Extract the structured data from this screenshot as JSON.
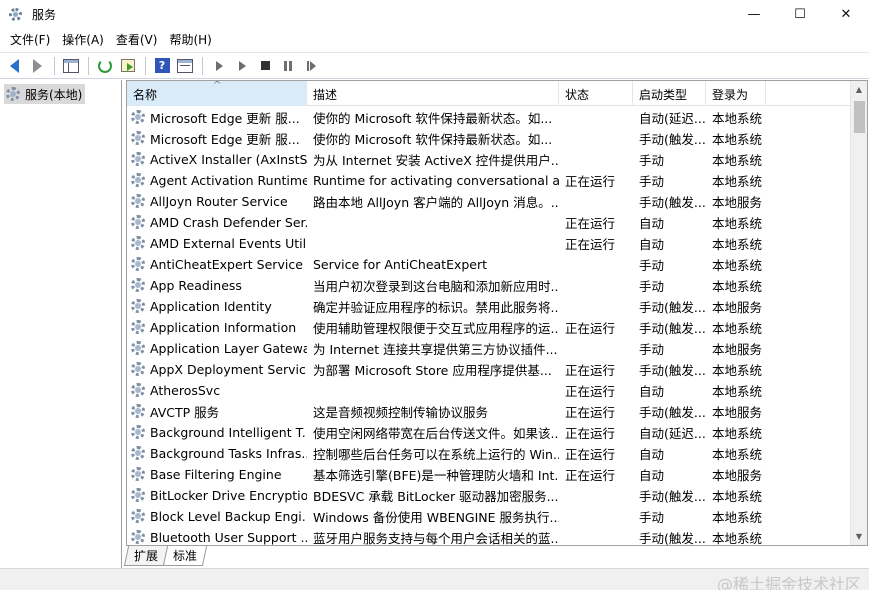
{
  "window": {
    "title": "服务",
    "controls": {
      "minimize": "—",
      "maximize": "☐",
      "close": "✕"
    }
  },
  "menu": [
    "文件(F)",
    "操作(A)",
    "查看(V)",
    "帮助(H)"
  ],
  "toolbar": {
    "icons": [
      "back-arrow-icon",
      "forward-arrow-icon",
      "console-tree-icon",
      "refresh-icon",
      "export-list-icon",
      "help-icon",
      "properties-icon",
      "start-service-icon",
      "start-service-alt-icon",
      "stop-service-icon",
      "pause-service-icon",
      "restart-service-icon"
    ],
    "help_glyph": "?"
  },
  "tree": {
    "root_label": "服务(本地)"
  },
  "columns": {
    "name": "名称",
    "desc": "描述",
    "status": "状态",
    "start": "启动类型",
    "logon": "登录为",
    "sort_indicator": "^"
  },
  "services": [
    {
      "name": "Microsoft Edge 更新 服...",
      "desc": "使你的 Microsoft 软件保持最新状态。如...",
      "status": "",
      "start": "自动(延迟...",
      "logon": "本地系统"
    },
    {
      "name": "Microsoft Edge 更新 服...",
      "desc": "使你的 Microsoft 软件保持最新状态。如...",
      "status": "",
      "start": "手动(触发...",
      "logon": "本地系统"
    },
    {
      "name": "ActiveX Installer (AxInstSV)",
      "desc": "为从 Internet 安装 ActiveX 控件提供用户...",
      "status": "",
      "start": "手动",
      "logon": "本地系统"
    },
    {
      "name": "Agent Activation Runtime...",
      "desc": "Runtime for activating conversational a...",
      "status": "正在运行",
      "start": "手动",
      "logon": "本地系统"
    },
    {
      "name": "AllJoyn Router Service",
      "desc": "路由本地 AllJoyn 客户端的 AllJoyn 消息。...",
      "status": "",
      "start": "手动(触发...",
      "logon": "本地服务"
    },
    {
      "name": "AMD Crash Defender Ser...",
      "desc": "",
      "status": "正在运行",
      "start": "自动",
      "logon": "本地系统"
    },
    {
      "name": "AMD External Events Utility",
      "desc": "",
      "status": "正在运行",
      "start": "自动",
      "logon": "本地系统"
    },
    {
      "name": "AntiCheatExpert Service",
      "desc": "Service for AntiCheatExpert",
      "status": "",
      "start": "手动",
      "logon": "本地系统"
    },
    {
      "name": "App Readiness",
      "desc": "当用户初次登录到这台电脑和添加新应用时...",
      "status": "",
      "start": "手动",
      "logon": "本地系统"
    },
    {
      "name": "Application Identity",
      "desc": "确定并验证应用程序的标识。禁用此服务将...",
      "status": "",
      "start": "手动(触发...",
      "logon": "本地服务"
    },
    {
      "name": "Application Information",
      "desc": "使用辅助管理权限便于交互式应用程序的运...",
      "status": "正在运行",
      "start": "手动(触发...",
      "logon": "本地系统"
    },
    {
      "name": "Application Layer Gatewa...",
      "desc": "为 Internet 连接共享提供第三方协议插件...",
      "status": "",
      "start": "手动",
      "logon": "本地服务"
    },
    {
      "name": "AppX Deployment Servic...",
      "desc": "为部署 Microsoft Store 应用程序提供基...",
      "status": "正在运行",
      "start": "手动(触发...",
      "logon": "本地系统"
    },
    {
      "name": "AtherosSvc",
      "desc": "",
      "status": "正在运行",
      "start": "自动",
      "logon": "本地系统"
    },
    {
      "name": "AVCTP 服务",
      "desc": "这是音频视频控制传输协议服务",
      "status": "正在运行",
      "start": "手动(触发...",
      "logon": "本地服务"
    },
    {
      "name": "Background Intelligent T...",
      "desc": "使用空闲网络带宽在后台传送文件。如果该...",
      "status": "正在运行",
      "start": "自动(延迟...",
      "logon": "本地系统"
    },
    {
      "name": "Background Tasks Infras...",
      "desc": "控制哪些后台任务可以在系统上运行的 Win...",
      "status": "正在运行",
      "start": "自动",
      "logon": "本地系统"
    },
    {
      "name": "Base Filtering Engine",
      "desc": "基本筛选引擎(BFE)是一种管理防火墙和 Int...",
      "status": "正在运行",
      "start": "自动",
      "logon": "本地服务"
    },
    {
      "name": "BitLocker Drive Encryptio...",
      "desc": "BDESVC 承载 BitLocker 驱动器加密服务...",
      "status": "",
      "start": "手动(触发...",
      "logon": "本地系统"
    },
    {
      "name": "Block Level Backup Engi...",
      "desc": "Windows 备份使用 WBENGINE 服务执行...",
      "status": "",
      "start": "手动",
      "logon": "本地系统"
    },
    {
      "name": "Bluetooth User Support ...",
      "desc": "蓝牙用户服务支持与每个用户会话相关的蓝...",
      "status": "",
      "start": "手动(触发...",
      "logon": "本地系统"
    }
  ],
  "tabs": [
    "扩展",
    "标准"
  ],
  "watermark": "@稀土掘金技术社区",
  "colors": {
    "accent": "#2a72c9",
    "sorted_header": "#d9ebf9",
    "tree_selected": "#d9d9d9"
  }
}
